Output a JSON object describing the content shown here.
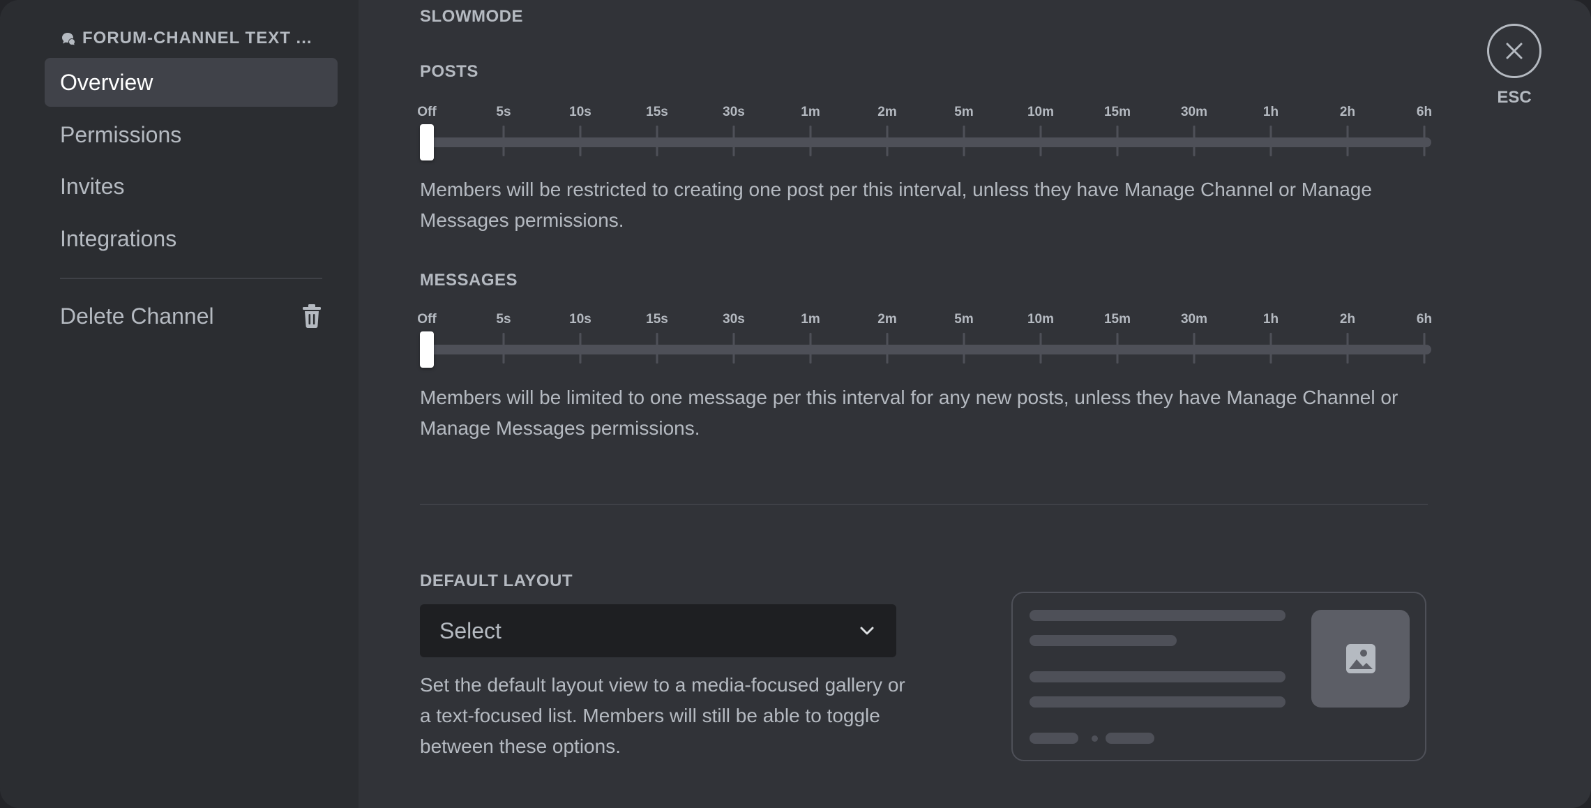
{
  "sidebar": {
    "header": "FORUM-CHANNEL TEXT ...",
    "items": [
      {
        "label": "Overview",
        "selected": true
      },
      {
        "label": "Permissions"
      },
      {
        "label": "Invites"
      },
      {
        "label": "Integrations"
      }
    ],
    "delete_label": "Delete Channel"
  },
  "slowmode": {
    "title": "SLOWMODE",
    "ticks": [
      "Off",
      "5s",
      "10s",
      "15s",
      "30s",
      "1m",
      "2m",
      "5m",
      "10m",
      "15m",
      "30m",
      "1h",
      "2h",
      "6h"
    ],
    "posts": {
      "label": "POSTS",
      "value": "Off",
      "description": "Members will be restricted to creating one post per this interval, unless they have Manage Channel or Manage Messages permissions."
    },
    "messages": {
      "label": "MESSAGES",
      "value": "Off",
      "description": "Members will be limited to one message per this interval for any new posts, unless they have Manage Channel or Manage Messages permissions."
    }
  },
  "default_layout": {
    "label": "DEFAULT LAYOUT",
    "select_value": "Select",
    "description": "Set the default layout view to a media-focused gallery or a text-focused list. Members will still be able to toggle between these options."
  },
  "close": {
    "esc_label": "ESC"
  },
  "colors": {
    "background": "#313338",
    "sidebar": "#2b2d31",
    "selected_item": "#404249",
    "text_muted": "#b5bac1",
    "select_bg": "#1e1f22",
    "track": "#4e5058"
  },
  "icons": [
    "forum-icon",
    "trash-icon",
    "chevron-down-icon",
    "image-icon",
    "close-icon"
  ]
}
